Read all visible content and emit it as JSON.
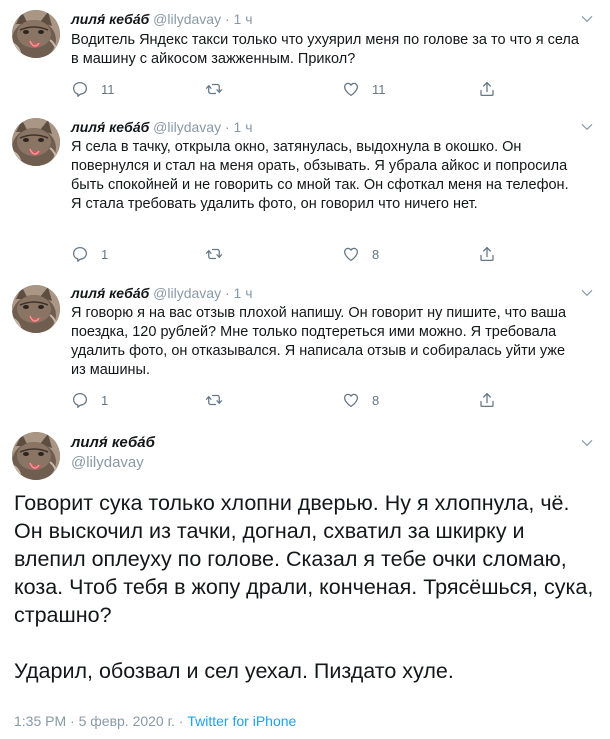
{
  "tweets": [
    {
      "name": "лиля́ кеба́б",
      "handle": "@lilydavay",
      "time": "1 ч",
      "text": "Водитель Яндекс такси только что ухуярил меня по голове за то что я села в машину с айкосом зажженным. Прикол?",
      "replies": "11",
      "retweets": "",
      "likes": "11"
    },
    {
      "name": "лиля́ кеба́б",
      "handle": "@lilydavay",
      "time": "1 ч",
      "text": "Я села в тачку, открыла окно, затянулась, выдохнула в окошко. Он повернулся и стал на меня орать, обзывать. Я убрала айкос и попросила быть спокойней и не говорить со мной так. Он сфоткал меня на телефон. Я стала требовать удалить фото, он говорил что ничего нет.",
      "replies": "1",
      "retweets": "",
      "likes": "8"
    },
    {
      "name": "лиля́ кеба́б",
      "handle": "@lilydavay",
      "time": "1 ч",
      "text": "Я говорю я на вас отзыв плохой напишу. Он говорит ну пишите, что ваша поездка, 120 рублей? Мне только подтереться ими можно. Я требовала удалить фото, он отказывался. Я написала отзыв и собиралась уйти уже из машины.",
      "replies": "1",
      "retweets": "",
      "likes": "8"
    }
  ],
  "main_tweet": {
    "name": "лиля́ кеба́б",
    "handle": "@lilydavay",
    "paragraph1": "Говорит сука только хлопни дверью. Ну я хлопнула, чё. Он выскочил из тачки, догнал, схватил за шкирку и влепил оплеуху по голове. Сказал я тебе очки сломаю, коза. Чтоб тебя в жопу драли, конченая. Трясёшься, сука, страшно?",
    "paragraph2": "Ударил, обозвал и сел уехал. Пиздато хуле.",
    "time": "1:35 PM",
    "date": "5 февр. 2020 г.",
    "source": "Twitter for iPhone"
  },
  "separator": "·",
  "icons": {
    "reply": "reply-icon",
    "retweet": "retweet-icon",
    "like": "like-icon",
    "share": "share-icon",
    "more": "chevron-down-icon"
  },
  "colors": {
    "text": "#14171a",
    "muted": "#8899a6",
    "action": "#657786",
    "link": "#1da1f2"
  }
}
